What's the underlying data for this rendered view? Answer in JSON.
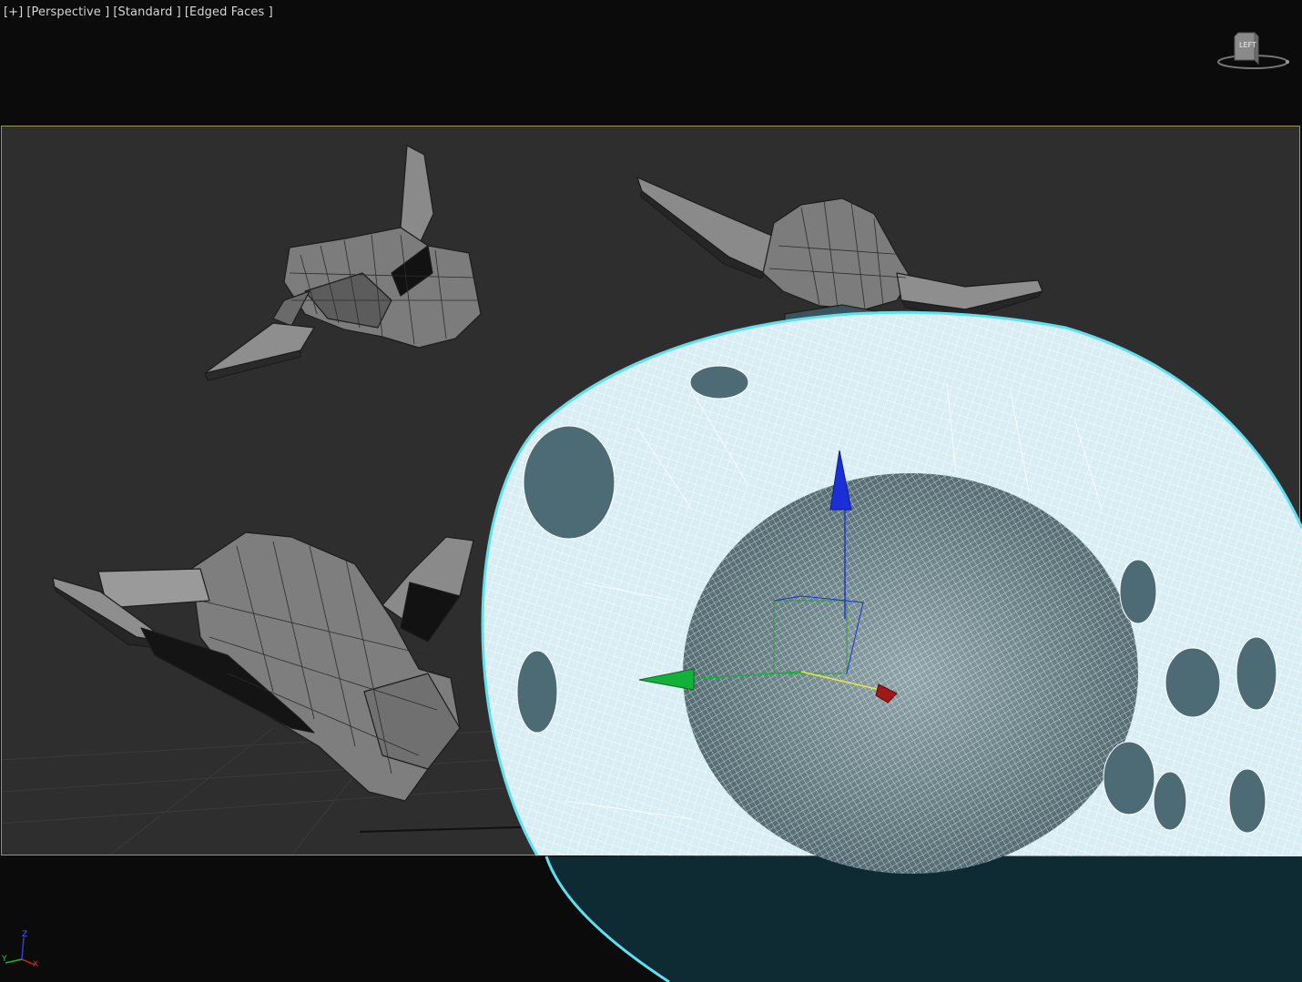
{
  "viewport": {
    "labels": [
      "[+]",
      "[Perspective ]",
      "[Standard ]",
      "[Edged Faces ]"
    ]
  },
  "viewcube": {
    "face_label": "LEFT"
  },
  "axis_tripod": {
    "x": "X",
    "y": "Y",
    "z": "Z"
  },
  "gizmo": {
    "z_label": "Z"
  },
  "colors": {
    "safe_frame": "#9b9a52",
    "selection_wire": "#eaf8ff",
    "selection_outline": "#5fe0f0",
    "gizmo_x": "#c21818",
    "gizmo_y": "#13b13a",
    "gizmo_z": "#1a2fd8"
  }
}
